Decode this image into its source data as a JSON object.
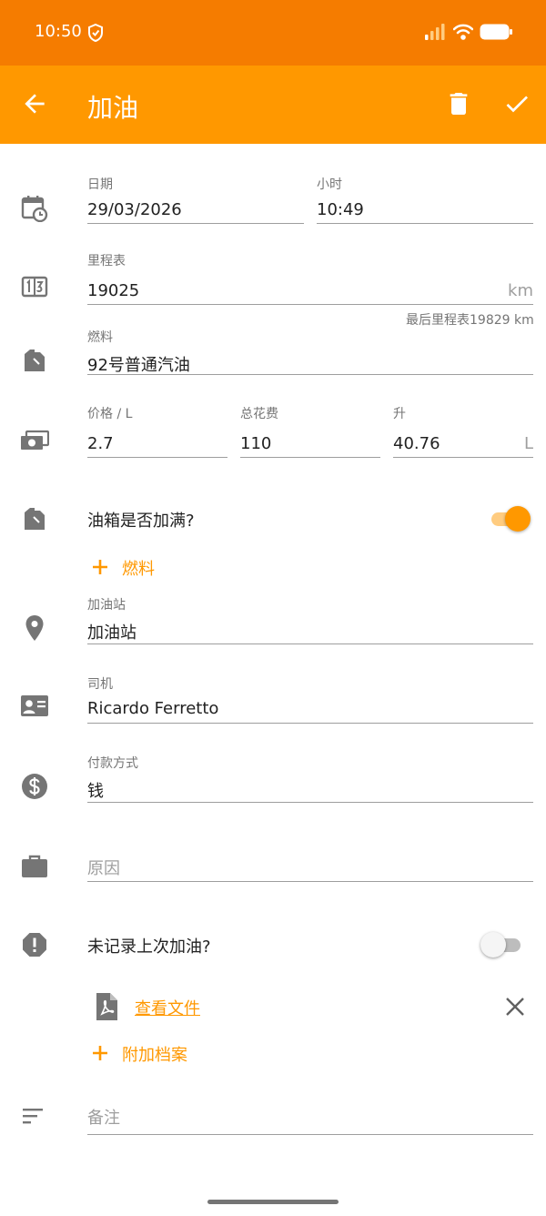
{
  "status_bar": {
    "time": "10:50"
  },
  "app_bar": {
    "title": "加油"
  },
  "date": {
    "label": "日期",
    "value": "29/03/2026"
  },
  "time": {
    "label": "小时",
    "value": "10:49"
  },
  "odometer": {
    "label": "里程表",
    "value": "19025",
    "unit": "km",
    "helper": "最后里程表19829 km"
  },
  "fuel": {
    "label": "燃料",
    "value": "92号普通汽油"
  },
  "price": {
    "label": "价格 / L",
    "value": "2.7"
  },
  "total": {
    "label": "总花费",
    "value": "110"
  },
  "liters": {
    "label": "升",
    "value": "40.76",
    "unit": "L"
  },
  "full_tank": {
    "label": "油箱是否加满?",
    "checked": true
  },
  "add_fuel": {
    "label": "燃料"
  },
  "station": {
    "label": "加油站",
    "value": "加油站"
  },
  "driver": {
    "label": "司机",
    "value": "Ricardo Ferretto"
  },
  "payment": {
    "label": "付款方式",
    "value": "钱"
  },
  "reason": {
    "placeholder": "原因"
  },
  "missed_refuel": {
    "label": "未记录上次加油?",
    "checked": false
  },
  "attachment": {
    "link": "查看文件"
  },
  "attach_file": {
    "label": "附加档案"
  },
  "notes": {
    "placeholder": "备注"
  },
  "colors": {
    "status_bar": "#f57c00",
    "app_bar": "#ff9800",
    "accent": "#ff9800",
    "icon_gray": "#757575"
  },
  "icons": {
    "calendar": "calendar-clock-icon",
    "odometer": "odometer-icon",
    "fuel": "fuel-can-icon",
    "money": "cash-icon",
    "full": "fuel-can-icon",
    "station": "location-pin-icon",
    "driver": "id-card-icon",
    "payment": "dollar-circle-icon",
    "reason": "briefcase-icon",
    "missed": "alert-octagon-icon",
    "file": "pdf-file-icon",
    "notes": "notes-sort-icon"
  }
}
